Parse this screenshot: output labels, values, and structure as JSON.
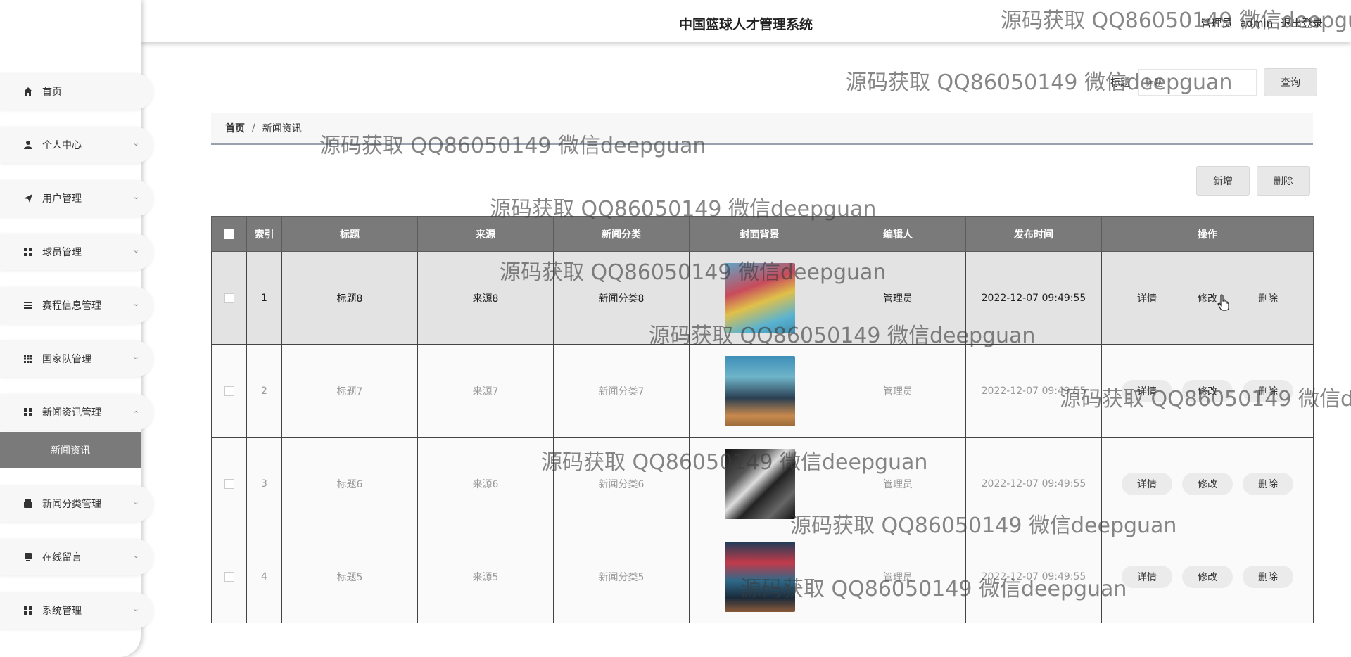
{
  "header": {
    "title": "中国篮球人才管理系统",
    "user_role": "管理员",
    "username": "admin",
    "logout": "退出登录"
  },
  "sidebar": {
    "items": [
      {
        "label": "首页",
        "icon": "home-icon",
        "chevron": ""
      },
      {
        "label": "个人中心",
        "icon": "user-icon",
        "chevron": "down"
      },
      {
        "label": "用户管理",
        "icon": "send-icon",
        "chevron": "down"
      },
      {
        "label": "球员管理",
        "icon": "grid-icon",
        "chevron": "down"
      },
      {
        "label": "赛程信息管理",
        "icon": "list-icon",
        "chevron": "down"
      },
      {
        "label": "国家队管理",
        "icon": "apps-icon",
        "chevron": "down"
      },
      {
        "label": "新闻资讯管理",
        "icon": "grid-icon",
        "chevron": "up"
      },
      {
        "label": "新闻分类管理",
        "icon": "wallet-icon",
        "chevron": "down"
      },
      {
        "label": "在线留言",
        "icon": "printer-icon",
        "chevron": "down"
      },
      {
        "label": "系统管理",
        "icon": "grid-icon",
        "chevron": "down"
      }
    ],
    "active_sub_item": "新闻资讯"
  },
  "search": {
    "label": "标题",
    "placeholder": "标题",
    "button": "查询"
  },
  "breadcrumb": {
    "home": "首页",
    "separator": "/",
    "current": "新闻资讯"
  },
  "actions": {
    "add": "新增",
    "delete": "删除"
  },
  "table": {
    "headers": [
      "索引",
      "标题",
      "来源",
      "新闻分类",
      "封面背景",
      "编辑人",
      "发布时间",
      "操作"
    ],
    "rows": [
      {
        "index": "1",
        "title": "标题8",
        "source": "来源8",
        "category": "新闻分类8",
        "editor": "管理员",
        "time": "2022-12-07 09:49:55",
        "cover": "#7cbccd"
      },
      {
        "index": "2",
        "title": "标题7",
        "source": "来源7",
        "category": "新闻分类7",
        "editor": "管理员",
        "time": "2022-12-07 09:49:55",
        "cover": "#4aa0c0"
      },
      {
        "index": "3",
        "title": "标题6",
        "source": "来源6",
        "category": "新闻分类6",
        "editor": "管理员",
        "time": "2022-12-07 09:49:55",
        "cover": "#2a2a2a"
      },
      {
        "index": "4",
        "title": "标题5",
        "source": "来源5",
        "category": "新闻分类5",
        "editor": "管理员",
        "time": "2022-12-07 09:49:55",
        "cover": "#3a6a8a"
      }
    ],
    "ops": {
      "detail": "详情",
      "edit": "修改",
      "delete": "删除"
    }
  },
  "watermark": "源码获取 QQ86050149 微信deepguan"
}
